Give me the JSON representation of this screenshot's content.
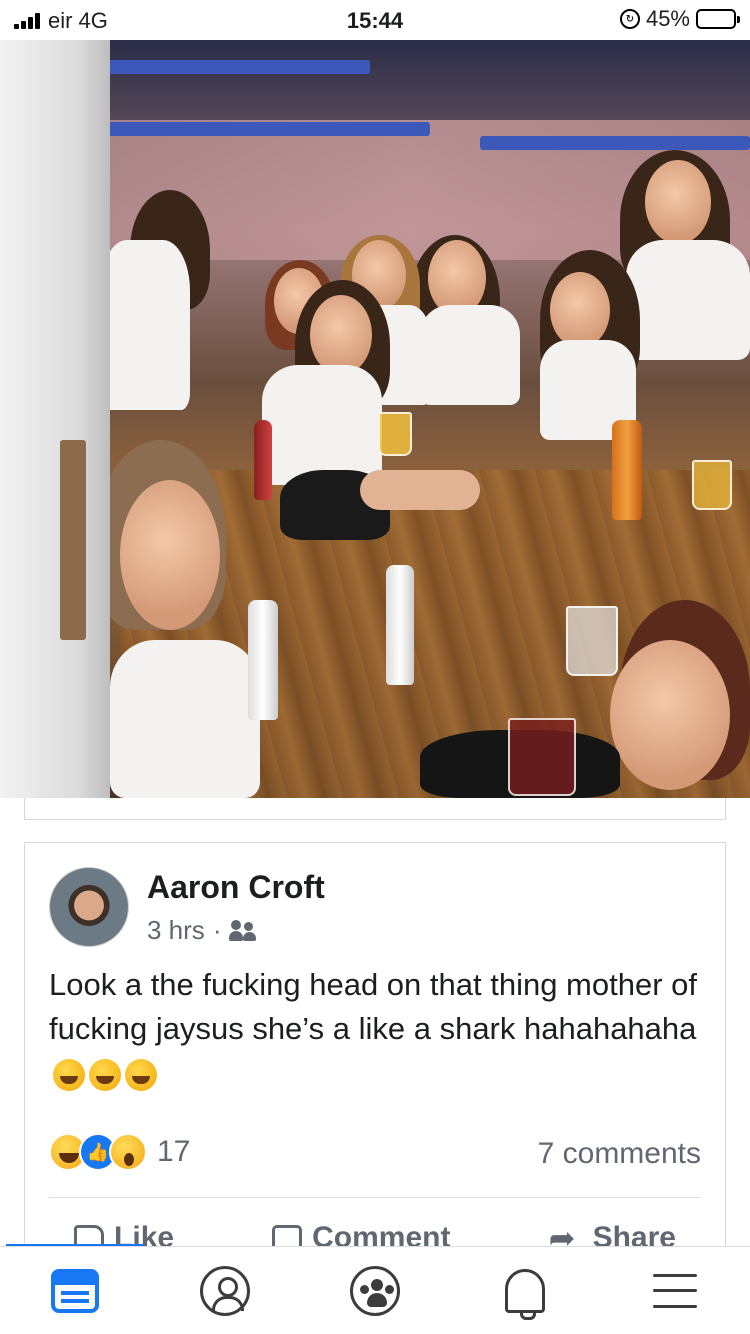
{
  "status_bar": {
    "carrier": "eir 4G",
    "time": "15:44",
    "battery_percent": "45%",
    "battery_level": 0.45
  },
  "photo": {
    "icon": "party-photo"
  },
  "post": {
    "author": "Aaron Croft",
    "time": "3 hrs",
    "separator": "·",
    "audience_icon": "friends-icon",
    "text": "Look a the fucking head on that thing mother of fucking jaysus she’s a like a shark hahahahaha",
    "emojis": [
      "rolling-on-floor-laughing",
      "rolling-on-floor-laughing",
      "rolling-on-floor-laughing"
    ],
    "reactions": [
      "haha",
      "like",
      "wow"
    ],
    "reaction_count": "17",
    "comments": "7 comments",
    "actions": {
      "like": "Like",
      "comment": "Comment",
      "share": "Share"
    }
  },
  "bottom_nav": [
    "feed",
    "profile",
    "groups",
    "notifications",
    "menu"
  ],
  "colors": {
    "accent": "#1877f2",
    "text": "#1c1e21",
    "muted": "#606770"
  }
}
